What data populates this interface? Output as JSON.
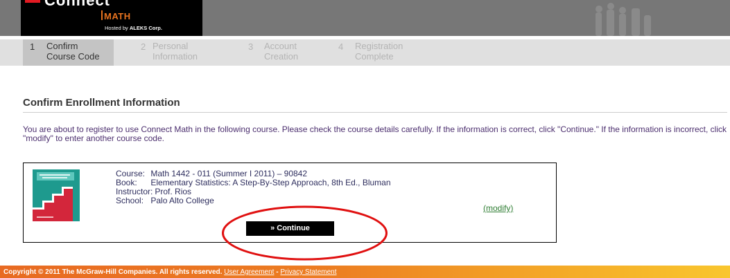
{
  "header": {
    "logo_text": "Connect",
    "product": "MATH",
    "hosted_by_prefix": "Hosted by",
    "hosted_by_company": "ALEKS Corp."
  },
  "steps": [
    {
      "number": "1",
      "label": "Confirm\nCourse Code",
      "state": "active"
    },
    {
      "number": "2",
      "label": "Personal\nInformation",
      "state": "inactive"
    },
    {
      "number": "3",
      "label": "Account\nCreation",
      "state": "inactive"
    },
    {
      "number": "4",
      "label": "Registration\nComplete",
      "state": "inactive"
    }
  ],
  "main": {
    "title": "Confirm Enrollment Information",
    "intro": "You are about to register to use Connect Math in the following course. Please check the course details carefully. If the information is correct, click \"Continue.\" If the information is incorrect, click \"modify\" to enter another course code."
  },
  "course": {
    "course_label": "Course:",
    "course_value": "Math 1442 - 011 (Summer I 2011) – 90842",
    "book_label": "Book:",
    "book_value": "Elementary Statistics: A Step-By-Step Approach, 8th Ed., Bluman",
    "instructor_label": "Instructor:",
    "instructor_value": "Prof. Rios",
    "school_label": "School:",
    "school_value": "Palo Alto College",
    "modify_label": "(modify)",
    "continue_label": "» Continue",
    "book_cover_icon": "book-cover-image"
  },
  "footer": {
    "copyright": "Copyright © 2011 The McGraw-Hill Companies. All rights reserved.",
    "user_agreement": "User Agreement",
    "separator": " - ",
    "privacy": "Privacy Statement"
  },
  "colors": {
    "header_gray": "#777777",
    "math_orange": "#e8731f",
    "intro_text": "#4b2e6e",
    "modify_green": "#2e7d32",
    "highlight_red": "#e01010",
    "footer_start": "#e86a22",
    "footer_end": "#f9c62e"
  }
}
